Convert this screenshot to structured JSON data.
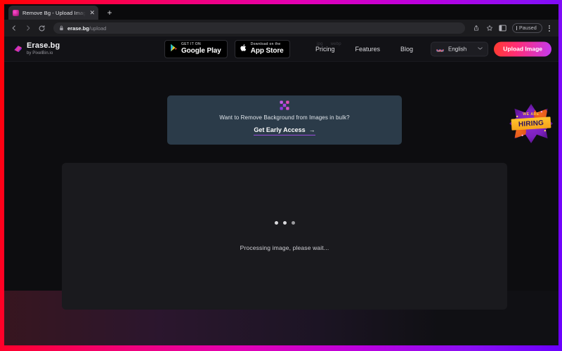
{
  "browser": {
    "tab": {
      "title": "Remove Bg - Upload Images to",
      "close_label": "✕",
      "favicon_name": "erasebg-favicon"
    },
    "newtab_label": "+",
    "toolbar": {
      "back_label": "←",
      "forward_label": "→",
      "reload_label": "⟳",
      "url_domain": "erase.bg",
      "url_path": "/upload",
      "share_label": "⇧",
      "bookmark_label": "☆",
      "sidebar_label": "◧",
      "paused_label": "Paused",
      "menu_label": "⋮"
    }
  },
  "site": {
    "logo": {
      "title": "Erase.bg",
      "subtitle": "by PixelBin.io"
    },
    "store_badges": [
      {
        "top": "GET IT ON",
        "bottom": "Google Play",
        "icon": "google-play-icon"
      },
      {
        "top": "Download on the",
        "bottom": "App Store",
        "icon": "apple-icon"
      }
    ],
    "nav": [
      {
        "label": "Pricing"
      },
      {
        "label": "Features"
      },
      {
        "label": "Blog"
      }
    ],
    "ghost_formats": [
      "jpg",
      "webp"
    ],
    "language": {
      "label": "English",
      "chevron": "⌄",
      "flag": "uk-flag"
    },
    "upload_button": "Upload Image"
  },
  "promo": {
    "icon_name": "pixelbin-x-icon",
    "text": "Want to Remove Background from Images in bulk?",
    "cta_label": "Get Early Access",
    "cta_arrow": "→"
  },
  "hiring": {
    "line1": "WE ARE",
    "line2": "HIRING"
  },
  "canvas": {
    "status": "Processing image, please wait..."
  },
  "colors": {
    "accent_gradient_start": "#ff3b30",
    "accent_gradient_end": "#c43bf0",
    "promo_bg": "#2b3b49",
    "promo_underline": "#9a4ddb",
    "canvas_bg": "#1a1a1e",
    "page_bg": "#0d0d10"
  }
}
